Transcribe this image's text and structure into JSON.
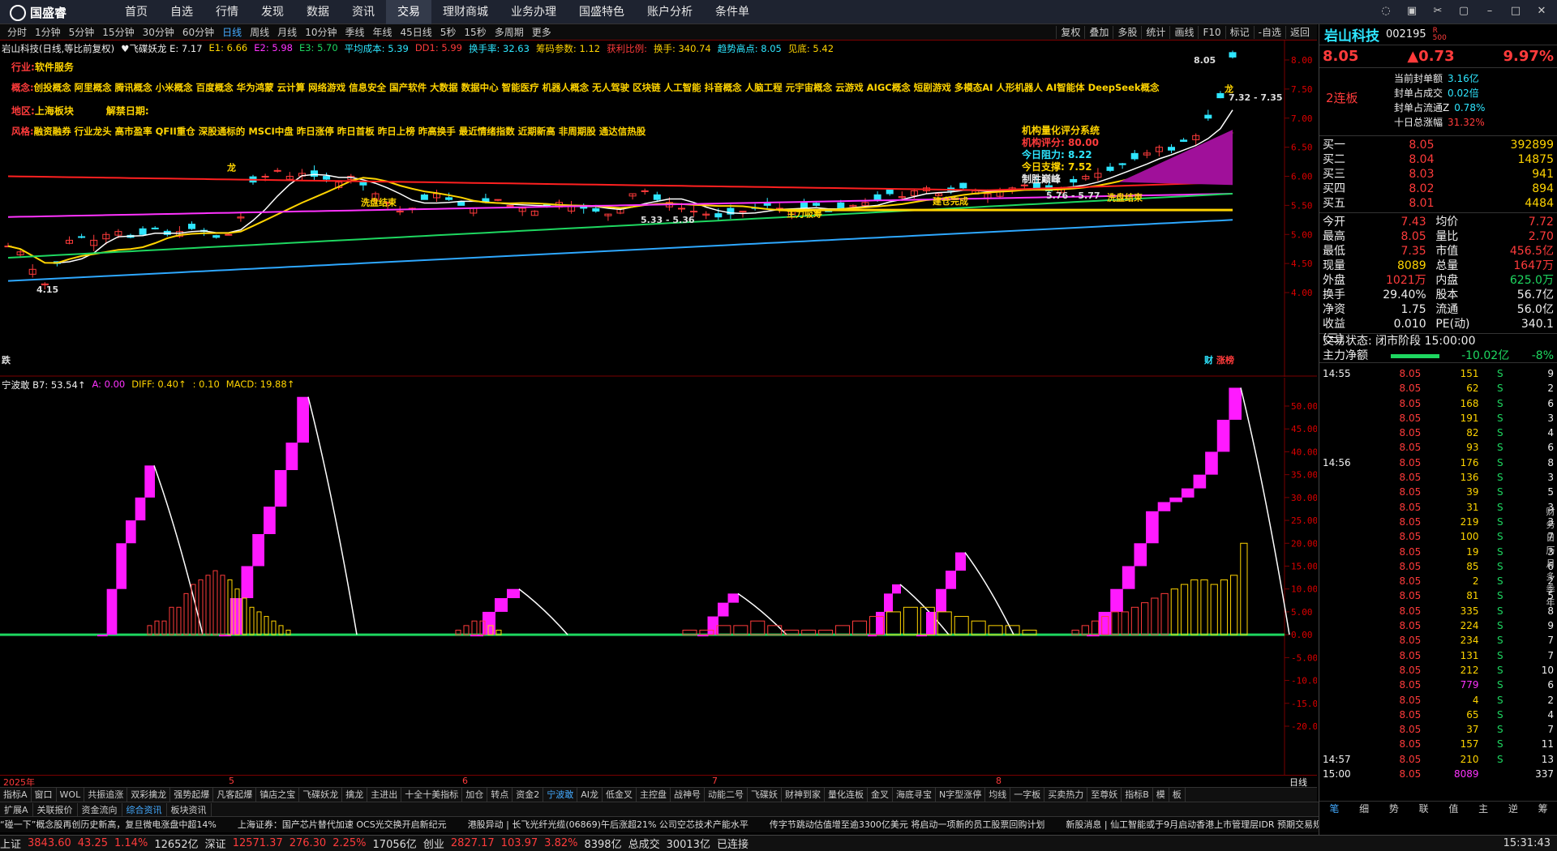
{
  "menu": {
    "logo": "国盛睿",
    "items": [
      "首页",
      "自选",
      "行情",
      "发现",
      "数据",
      "资讯",
      "交易",
      "理财商城",
      "业务办理",
      "国盛特色",
      "账户分析",
      "条件单"
    ],
    "active": "交易"
  },
  "periods": {
    "items": [
      "分时",
      "1分钟",
      "5分钟",
      "15分钟",
      "30分钟",
      "60分钟",
      "日线",
      "周线",
      "月线",
      "10分钟",
      "季线",
      "年线",
      "45日线",
      "5秒",
      "15秒",
      "多周期",
      "更多"
    ],
    "active": "日线"
  },
  "tools": [
    "复权",
    "叠加",
    "多股",
    "统计",
    "画线",
    "F10",
    "标记",
    "-自选",
    "返回"
  ],
  "infoline": {
    "items": [
      {
        "t": "岩山科技(日线,等比前复权)",
        "c": "#eee"
      },
      {
        "t": "♥飞碟妖龙 E: 7.17",
        "c": "#eee"
      },
      {
        "t": "E1: 6.66",
        "c": "#ffd400"
      },
      {
        "t": "E2: 5.98",
        "c": "#ff33ff"
      },
      {
        "t": "E3: 5.70",
        "c": "#1ed760"
      },
      {
        "t": "平均成本: 5.39",
        "c": "#2ee6ff"
      },
      {
        "t": "DD1: 5.99",
        "c": "#ff3b3b"
      },
      {
        "t": "换手率: 32.63",
        "c": "#2ee6ff"
      },
      {
        "t": "筹码参数: 1.12",
        "c": "#ffd400"
      },
      {
        "t": "获利比例:",
        "c": "#ff3b3b"
      },
      {
        "t": "换手: 340.74",
        "c": "#ffd400"
      },
      {
        "t": "趋势高点: 8.05",
        "c": "#2ee6ff"
      },
      {
        "t": "见底: 5.42",
        "c": "#ffd400"
      }
    ]
  },
  "tags": {
    "industry_label": "行业:",
    "industry": "软件服务",
    "concept_label": "概念:",
    "concepts": "创投概念 阿里概念 腾讯概念 小米概念 百度概念 华为鸿蒙 云计算 网络游戏 信息安全 国产软件 大数据 数据中心 智能医疗 机器人概念 无人驾驶 区块链 人工智能 抖音概念 人脑工程 元宇宙概念 云游戏 AIGC概念 短剧游戏 多模态AI 人形机器人 AI智能体 DeepSeek概念",
    "region_label": "地区:",
    "region": "上海板块",
    "unlock_label": "解禁日期:",
    "style_label": "风格:",
    "style": "融资融券 行业龙头 高市盈率 QFII重仓 深股通标的 MSCI中盘 昨日涨停 昨日首板 昨日上榜 昨高换手 最近情绪指数 近期新高 非周期股 通达信热股"
  },
  "score": {
    "title": "机构量化评分系统",
    "rating": "机构评分: 80.00",
    "resist": "今日阻力:  8.22",
    "support": "今日支撑:  7.52",
    "note": "制胜巅峰"
  },
  "annotations": {
    "wash1": "洗盘结束",
    "wash2": "洗盘结束",
    "main_absorb": "主力吸筹",
    "build": "建仓完成",
    "long": "龙",
    "long2": "龙",
    "low_price": "4.15",
    "range1": "5.33 - 5.36",
    "range2": "5.76 - 5.77",
    "high_price": "8.05",
    "range3": "7.32 - 7.35",
    "bottom_left": "跌",
    "bottom_cai": "财",
    "bottom_zt": "涨榜"
  },
  "main_axis": [
    "8.00",
    "7.50",
    "7.00",
    "6.50",
    "6.00",
    "5.50",
    "5.00",
    "4.50",
    "4.00"
  ],
  "ind_header": [
    {
      "t": "宁波敢 B7: 53.54↑",
      "c": "#eee"
    },
    {
      "t": "A: 0.00",
      "c": "#ff33ff"
    },
    {
      "t": "DIFF: 0.40↑",
      "c": "#ffd400"
    },
    {
      "t": ": 0.10",
      "c": "#ffd400"
    },
    {
      "t": "MACD: 19.88↑",
      "c": "#ffd400"
    }
  ],
  "ind_axis": [
    "50.00",
    "45.00",
    "40.00",
    "35.00",
    "30.00",
    "25.00",
    "20.00",
    "15.00",
    "10.00",
    "5.00",
    "0.00",
    "-5.00",
    "-10.00",
    "-15.00",
    "-20.00"
  ],
  "time_axis": {
    "labels": [
      "2025年",
      "5",
      "6",
      "7",
      "8"
    ],
    "period": "日线"
  },
  "tabs": [
    "指标A",
    "窗口",
    "WOL",
    "共振追涨",
    "双彩擒龙",
    "强势起爆",
    "凡客起爆",
    "镇店之宝",
    "飞碟妖龙",
    "擒龙",
    "主进出",
    "十全十美指标",
    "加仓",
    "转点",
    "资金2",
    "宁波敢",
    "AI龙",
    "低金叉",
    "主控盘",
    "战神号",
    "动能二号",
    "飞碟妖",
    "财神到家",
    "量化连板",
    "金叉",
    "海底寻宝",
    "N字型涨停",
    "均线",
    "一字板",
    "买卖热力",
    "至尊妖",
    "指标B",
    "模",
    "板"
  ],
  "tabs_active": "宁波敢",
  "tabs2": [
    "扩展A",
    "关联报价",
    "资金流向",
    "综合资讯",
    "板块资讯"
  ],
  "tabs2_active": "综合资讯",
  "news": [
    {
      "t": "“碰一下”概念股再创历史新高，复旦微电涨盘中超14%",
      "c": "#ddd"
    },
    {
      "t": "上海证券：国产芯片替代加速 OCS光交换开启新纪元",
      "c": "#ddd"
    },
    {
      "t": "港股异动 | 长飞光纤光缆(06869)午后涨超21% 公司空芯技术产能水平",
      "c": "#ddd"
    },
    {
      "t": "传字节跳动估值增至逾3300亿美元 将启动一项新的员工股票回购计划",
      "c": "#ddd"
    },
    {
      "t": "新股消息 | 仙工智能或于9月启动香港上市管理层IDR 预期交易规模约",
      "c": "#ddd"
    }
  ],
  "status": [
    {
      "t": "上证",
      "c": "#ddd"
    },
    {
      "t": "3843.60",
      "c": "#ff3b3b"
    },
    {
      "t": "43.25",
      "c": "#ff3b3b"
    },
    {
      "t": "1.14%",
      "c": "#ff3b3b"
    },
    {
      "t": "12652亿",
      "c": "#ddd"
    },
    {
      "t": "深证",
      "c": "#ddd"
    },
    {
      "t": "12571.37",
      "c": "#ff3b3b"
    },
    {
      "t": "276.30",
      "c": "#ff3b3b"
    },
    {
      "t": "2.25%",
      "c": "#ff3b3b"
    },
    {
      "t": "17056亿",
      "c": "#ddd"
    },
    {
      "t": "创业",
      "c": "#ddd"
    },
    {
      "t": "2827.17",
      "c": "#ff3b3b"
    },
    {
      "t": "103.97",
      "c": "#ff3b3b"
    },
    {
      "t": "3.82%",
      "c": "#ff3b3b"
    },
    {
      "t": "8398亿",
      "c": "#ddd"
    },
    {
      "t": "总成交",
      "c": "#ddd"
    },
    {
      "t": "30013亿",
      "c": "#ddd"
    },
    {
      "t": "已连接",
      "c": "#ddd"
    }
  ],
  "clock": "15:31:43",
  "stock": {
    "name": "岩山科技",
    "code": "002195",
    "tagR": "R",
    "tag500": "500",
    "price": "8.05",
    "change": "▲0.73",
    "pct": "9.97%",
    "streak": "2连板",
    "seal": [
      [
        "当前封单额",
        "3.16亿"
      ],
      [
        "封单占成交",
        "0.02倍"
      ],
      [
        "封单占流通Z",
        "0.78%"
      ],
      [
        "十日总涨幅",
        "31.32%"
      ]
    ],
    "bids": [
      [
        "买一",
        "8.05",
        "392899"
      ],
      [
        "买二",
        "8.04",
        "14875"
      ],
      [
        "买三",
        "8.03",
        "941"
      ],
      [
        "买四",
        "8.02",
        "894"
      ],
      [
        "买五",
        "8.01",
        "4484"
      ]
    ],
    "quote": [
      [
        "今开",
        "7.43",
        "均价",
        "7.72"
      ],
      [
        "最高",
        "8.05",
        "量比",
        "2.70"
      ],
      [
        "最低",
        "7.35",
        "市值",
        "456.5亿"
      ],
      [
        "现量",
        "8089",
        "总量",
        "1647万"
      ],
      [
        "外盘",
        "1021万",
        "内盘",
        "625.0万"
      ],
      [
        "换手",
        "29.40%",
        "股本",
        "56.7亿"
      ],
      [
        "净资",
        "1.75",
        "流通",
        "56.0亿"
      ],
      [
        "收益(三)",
        "0.010",
        "PE(动)",
        "340.1"
      ]
    ],
    "trade_state": "交易状态: 闭市阶段 15:00:00",
    "netflow_label": "主力净额",
    "netflow": "-10.02亿",
    "netflow_pct": "-8%",
    "ticks": [
      [
        "14:55",
        "8.05",
        "151",
        "S",
        "9"
      ],
      [
        "",
        "8.05",
        "62",
        "S",
        "2"
      ],
      [
        "",
        "8.05",
        "168",
        "S",
        "6"
      ],
      [
        "",
        "8.05",
        "191",
        "S",
        "3"
      ],
      [
        "",
        "8.05",
        "82",
        "S",
        "4"
      ],
      [
        "",
        "8.05",
        "93",
        "S",
        "6"
      ],
      [
        "14:56",
        "8.05",
        "176",
        "S",
        "8"
      ],
      [
        "",
        "8.05",
        "136",
        "S",
        "3"
      ],
      [
        "",
        "8.05",
        "39",
        "S",
        "5"
      ],
      [
        "",
        "8.05",
        "31",
        "S",
        "3"
      ],
      [
        "",
        "8.05",
        "219",
        "S",
        "3"
      ],
      [
        "",
        "8.05",
        "100",
        "S",
        "7"
      ],
      [
        "",
        "8.05",
        "19",
        "S",
        "3"
      ],
      [
        "",
        "8.05",
        "85",
        "S",
        "6"
      ],
      [
        "",
        "8.05",
        "2",
        "S",
        "2"
      ],
      [
        "",
        "8.05",
        "81",
        "S",
        "5"
      ],
      [
        "",
        "8.05",
        "335",
        "S",
        "8"
      ],
      [
        "",
        "8.05",
        "224",
        "S",
        "9"
      ],
      [
        "",
        "8.05",
        "234",
        "S",
        "7"
      ],
      [
        "",
        "8.05",
        "131",
        "S",
        "7"
      ],
      [
        "",
        "8.05",
        "212",
        "S",
        "10"
      ],
      [
        "",
        "8.05",
        "779",
        "S",
        "6"
      ],
      [
        "",
        "8.05",
        "4",
        "S",
        "2"
      ],
      [
        "",
        "8.05",
        "65",
        "S",
        "4"
      ],
      [
        "",
        "8.05",
        "37",
        "S",
        "7"
      ],
      [
        "",
        "8.05",
        "157",
        "S",
        "11"
      ],
      [
        "14:57",
        "8.05",
        "210",
        "S",
        "13"
      ],
      [
        "15:00",
        "8.05",
        "8089",
        "",
        "337"
      ]
    ],
    "side_tabs": [
      "笔",
      "细",
      "势",
      "联",
      "值",
      "主",
      "逆",
      "筹"
    ],
    "vert_tabs": [
      "财",
      "务",
      "日",
      "历",
      "月",
      "多",
      "季",
      "年"
    ]
  }
}
